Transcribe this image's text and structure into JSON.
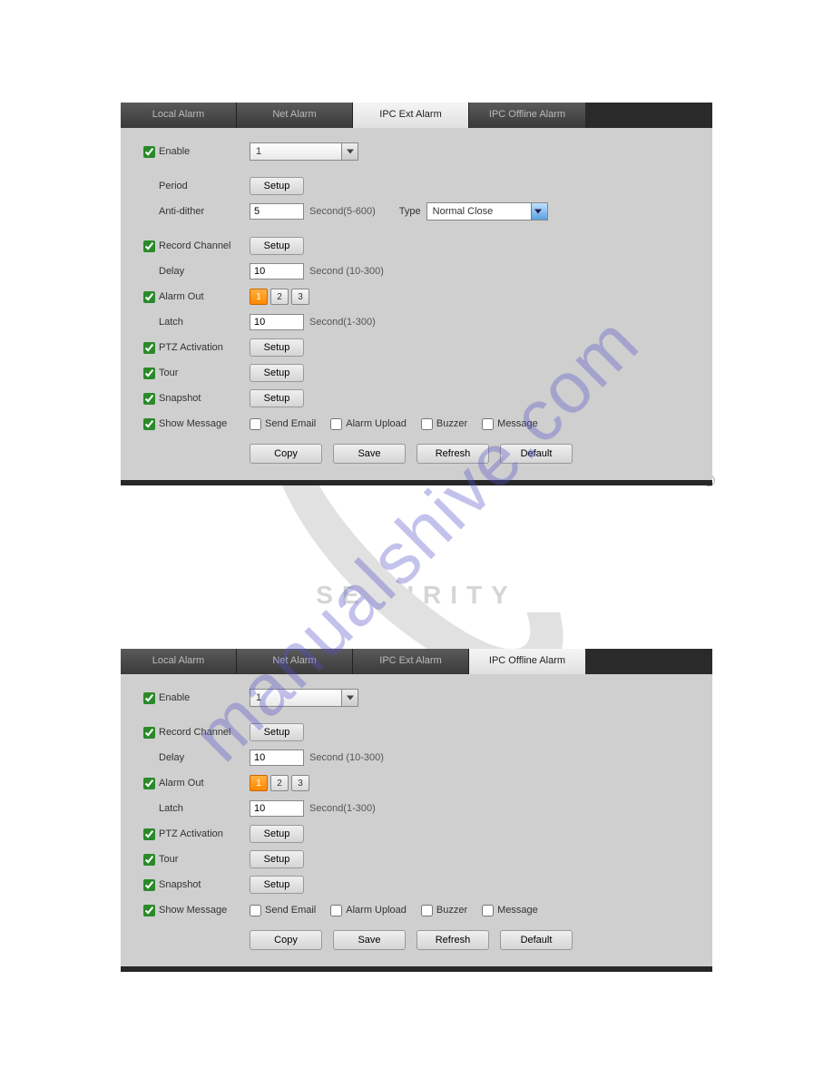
{
  "watermark": "manualshive.com",
  "logo_text": "SECURITY",
  "panel1": {
    "tabs": [
      "Local Alarm",
      "Net Alarm",
      "IPC Ext Alarm",
      "IPC Offline Alarm"
    ],
    "active": 2,
    "enable": {
      "label": "Enable",
      "checked": true,
      "select": "1"
    },
    "period": {
      "label": "Period",
      "button": "Setup"
    },
    "anti_dither": {
      "label": "Anti-dither",
      "value": "5",
      "hint": "Second(5-600)",
      "type_label": "Type",
      "type_value": "Normal Close"
    },
    "record_channel": {
      "label": "Record Channel",
      "checked": true,
      "button": "Setup"
    },
    "delay": {
      "label": "Delay",
      "value": "10",
      "hint": "Second (10-300)"
    },
    "alarm_out": {
      "label": "Alarm Out",
      "checked": true,
      "items": [
        "1",
        "2",
        "3"
      ],
      "active": 0
    },
    "latch": {
      "label": "Latch",
      "value": "10",
      "hint": "Second(1-300)"
    },
    "ptz": {
      "label": "PTZ Activation",
      "checked": true,
      "button": "Setup"
    },
    "tour": {
      "label": "Tour",
      "checked": true,
      "button": "Setup"
    },
    "snapshot": {
      "label": "Snapshot",
      "checked": true,
      "button": "Setup"
    },
    "show_msg": {
      "label": "Show Message",
      "checked": true,
      "opts": [
        {
          "label": "Send Email",
          "checked": false
        },
        {
          "label": "Alarm Upload",
          "checked": false
        },
        {
          "label": "Buzzer",
          "checked": false
        },
        {
          "label": "Message",
          "checked": false
        }
      ]
    },
    "buttons": [
      "Copy",
      "Save",
      "Refresh",
      "Default"
    ]
  },
  "panel2": {
    "tabs": [
      "Local Alarm",
      "Net Alarm",
      "IPC Ext Alarm",
      "IPC Offline Alarm"
    ],
    "active": 3,
    "enable": {
      "label": "Enable",
      "checked": true,
      "select": "1"
    },
    "record_channel": {
      "label": "Record Channel",
      "checked": true,
      "button": "Setup"
    },
    "delay": {
      "label": "Delay",
      "value": "10",
      "hint": "Second (10-300)"
    },
    "alarm_out": {
      "label": "Alarm Out",
      "checked": true,
      "items": [
        "1",
        "2",
        "3"
      ],
      "active": 0
    },
    "latch": {
      "label": "Latch",
      "value": "10",
      "hint": "Second(1-300)"
    },
    "ptz": {
      "label": "PTZ Activation",
      "checked": true,
      "button": "Setup"
    },
    "tour": {
      "label": "Tour",
      "checked": true,
      "button": "Setup"
    },
    "snapshot": {
      "label": "Snapshot",
      "checked": true,
      "button": "Setup"
    },
    "show_msg": {
      "label": "Show Message",
      "checked": true,
      "opts": [
        {
          "label": "Send Email",
          "checked": false
        },
        {
          "label": "Alarm Upload",
          "checked": false
        },
        {
          "label": "Buzzer",
          "checked": false
        },
        {
          "label": "Message",
          "checked": false
        }
      ]
    },
    "buttons": [
      "Copy",
      "Save",
      "Refresh",
      "Default"
    ]
  }
}
